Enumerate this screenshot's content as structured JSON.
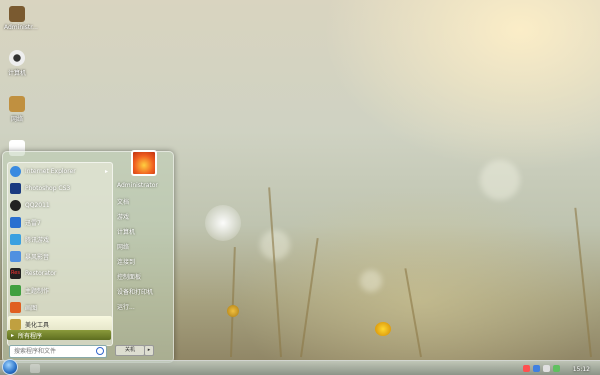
{
  "desktop": {
    "icons": [
      {
        "label": "Administr...",
        "color": "#7a5a30"
      },
      {
        "label": "计算机",
        "color": "#eeeeee"
      },
      {
        "label": "网络",
        "color": "#c09040"
      },
      {
        "label": "",
        "color": "#ffffff"
      }
    ]
  },
  "start_menu": {
    "programs": [
      {
        "label": "Internet Explorer",
        "color": "#3a8ae0",
        "has_arrow": true
      },
      {
        "label": "Photoshop CS3",
        "color": "#1a3a80",
        "has_arrow": false
      },
      {
        "label": "QQ2011",
        "color": "#222222",
        "has_arrow": false
      },
      {
        "label": "迅雷7",
        "color": "#2a70d0",
        "has_arrow": false
      },
      {
        "label": "腾讯游戏",
        "color": "#3aa0e0",
        "has_arrow": false
      },
      {
        "label": "暴风影音",
        "color": "#5090e0",
        "has_arrow": false
      },
      {
        "label": "Restorator",
        "color": "#202020",
        "has_arrow": false
      },
      {
        "label": "主题制作",
        "color": "#40a040",
        "has_arrow": false
      },
      {
        "label": "画图",
        "color": "#e06020",
        "has_arrow": false
      },
      {
        "label": "美化工具",
        "color": "#c0a040",
        "has_arrow": false,
        "highlighted": true
      }
    ],
    "all_programs_label": "所有程序",
    "search_placeholder": "搜索程序和文件",
    "right_items": [
      "Administrator",
      "文档",
      "游戏",
      "计算机",
      "网络",
      "连接到",
      "控制面板",
      "设备和打印机",
      "运行..."
    ],
    "shutdown_label": "关机"
  },
  "taskbar": {
    "clock": "15:12"
  }
}
